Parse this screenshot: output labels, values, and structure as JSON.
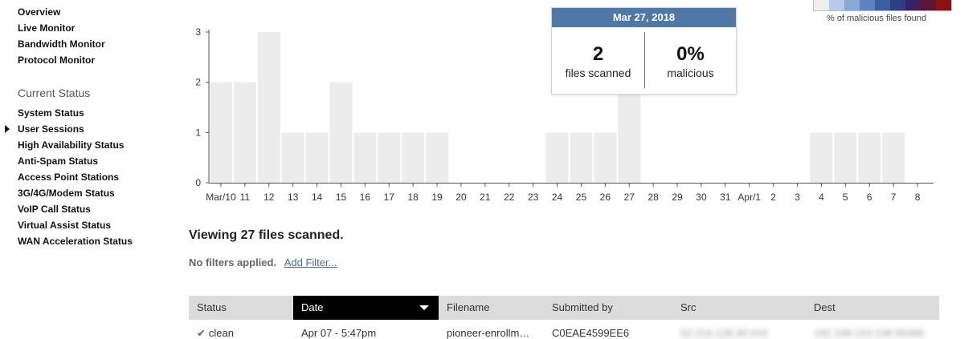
{
  "sidebar": {
    "top_items": [
      "Overview",
      "Live Monitor",
      "Bandwidth Monitor",
      "Protocol Monitor"
    ],
    "section_heading": "Current Status",
    "status_items": [
      "System Status",
      "User Sessions",
      "High Availability Status",
      "Anti-Spam Status",
      "Access Point Stations",
      "3G/4G/Modem Status",
      "VoIP Call Status",
      "Virtual Assist Status",
      "WAN Acceleration Status"
    ],
    "current_item_index": 1
  },
  "chart_data": {
    "type": "bar",
    "categories": [
      "Mar/10",
      "11",
      "12",
      "13",
      "14",
      "15",
      "16",
      "17",
      "18",
      "19",
      "20",
      "21",
      "22",
      "23",
      "24",
      "25",
      "26",
      "27",
      "28",
      "29",
      "30",
      "31",
      "Apr/1",
      "2",
      "3",
      "4",
      "5",
      "6",
      "7",
      "8"
    ],
    "values": [
      2,
      2,
      3,
      1,
      1,
      2,
      1,
      1,
      1,
      1,
      0,
      0,
      0,
      0,
      1,
      1,
      1,
      2,
      0,
      0,
      0,
      0,
      0,
      0,
      0,
      1,
      1,
      1,
      1,
      0
    ],
    "y_ticks": [
      "0",
      "1",
      "2",
      "3"
    ],
    "ylim": [
      0,
      3
    ],
    "bar_color": "#ececec",
    "axis_color": "#555555",
    "grid": false
  },
  "tooltip": {
    "date": "Mar 27, 2018",
    "files_value": "2",
    "files_label": "files scanned",
    "malicious_value": "0%",
    "malicious_label": "malicious",
    "header_color": "#4e79a7"
  },
  "legend": {
    "label": "% of malicious files found",
    "colors": [
      "#eeeeee",
      "#b7cbe8",
      "#8aa9d4",
      "#5e83bd",
      "#3c5ea3",
      "#2d3e82",
      "#3a2163",
      "#5a1436",
      "#8e1010"
    ]
  },
  "summary": {
    "viewing": "Viewing 27 files scanned.",
    "no_filters": "No filters applied.",
    "add_filter": "Add Filter..."
  },
  "table": {
    "columns": [
      "Status",
      "Date",
      "Filename",
      "Submitted by",
      "Src",
      "Dest"
    ],
    "sorted_column": "Date",
    "rows": [
      {
        "status": "clean",
        "date": "Apr 07 - 5:47pm",
        "filename": "pioneer-enrollm…",
        "submitted_by": "C0EAE4599EE6",
        "src": "52.216.128.30:443",
        "dest": "192.168.153.138:56366"
      }
    ]
  }
}
